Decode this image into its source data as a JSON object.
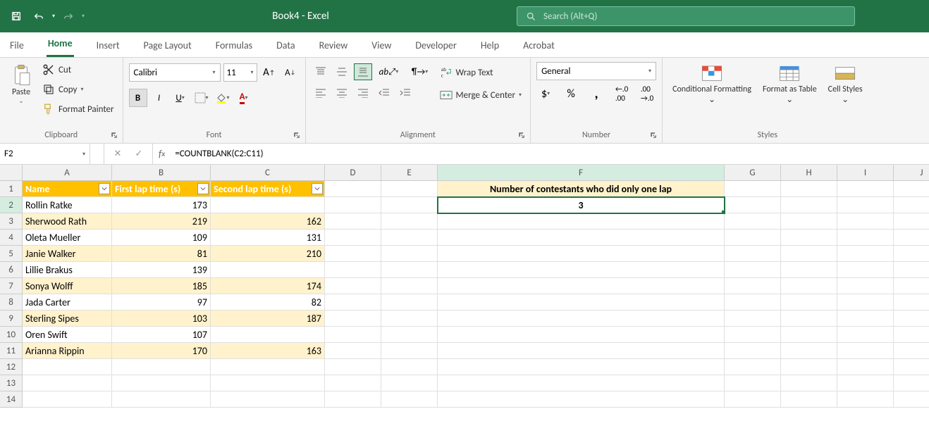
{
  "title": "Book4  -  Excel",
  "search_placeholder": "Search (Alt+Q)",
  "tabs": [
    "File",
    "Home",
    "Insert",
    "Page Layout",
    "Formulas",
    "Data",
    "Review",
    "View",
    "Developer",
    "Help",
    "Acrobat"
  ],
  "active_tab": 1,
  "clipboard": {
    "cut": "Cut",
    "copy": "Copy",
    "format_painter": "Format Painter",
    "paste": "Paste",
    "label": "Clipboard"
  },
  "font": {
    "name": "Calibri",
    "size": "11",
    "label": "Font"
  },
  "alignment": {
    "wrap": "Wrap Text",
    "merge": "Merge & Center",
    "label": "Alignment"
  },
  "number": {
    "format": "General",
    "label": "Number"
  },
  "styles": {
    "cond": "Conditional Formatting",
    "table": "Format as Table",
    "cell": "Cell Styles",
    "label": "Styles"
  },
  "namebox": "F2",
  "formula": "=COUNTBLANK(C2:C11)",
  "columns": [
    "A",
    "B",
    "C",
    "D",
    "E",
    "F",
    "G",
    "H",
    "I",
    "J"
  ],
  "col_widths": [
    "cw-A",
    "cw-B",
    "cw-C",
    "cw-D",
    "cw-E",
    "cw-F",
    "cw-G",
    "cw-H",
    "cw-I",
    "cw-J"
  ],
  "table_headers": [
    "Name",
    "First lap time (s)",
    "Second lap time (s)"
  ],
  "table_rows": [
    {
      "name": "Rollin Ratke",
      "lap1": "173",
      "lap2": ""
    },
    {
      "name": "Sherwood Rath",
      "lap1": "219",
      "lap2": "162"
    },
    {
      "name": "Oleta Mueller",
      "lap1": "109",
      "lap2": "131"
    },
    {
      "name": "Janie Walker",
      "lap1": "81",
      "lap2": "210"
    },
    {
      "name": "Lillie Brakus",
      "lap1": "139",
      "lap2": ""
    },
    {
      "name": "Sonya Wolff",
      "lap1": "185",
      "lap2": "174"
    },
    {
      "name": "Jada Carter",
      "lap1": "97",
      "lap2": "82"
    },
    {
      "name": "Sterling Sipes",
      "lap1": "103",
      "lap2": "187"
    },
    {
      "name": "Oren Swift",
      "lap1": "107",
      "lap2": ""
    },
    {
      "name": "Arianna Rippin",
      "lap1": "170",
      "lap2": "163"
    }
  ],
  "f1_label": "Number of contestants who did only one lap",
  "f2_value": "3",
  "selected_cell": "F2",
  "row_count": 14
}
